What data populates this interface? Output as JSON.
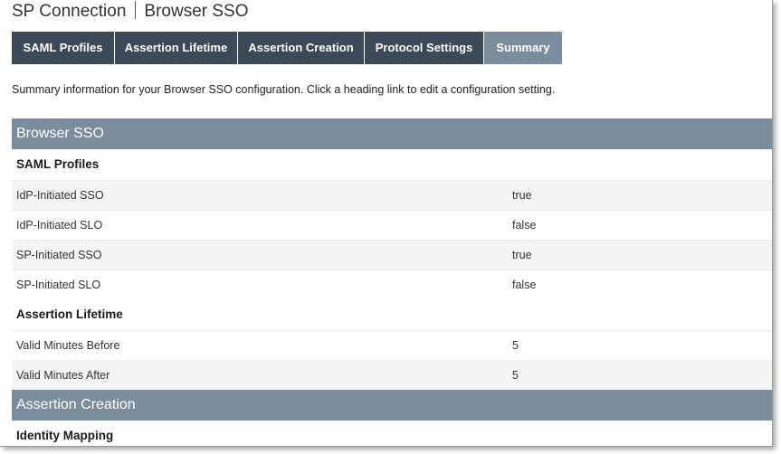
{
  "header": {
    "title": "SP Connection",
    "subtitle": "Browser SSO"
  },
  "tabs": [
    {
      "label": "SAML Profiles",
      "active": false
    },
    {
      "label": "Assertion Lifetime",
      "active": false
    },
    {
      "label": "Assertion Creation",
      "active": false
    },
    {
      "label": "Protocol Settings",
      "active": false
    },
    {
      "label": "Summary",
      "active": true
    }
  ],
  "intro_text": "Summary information for your Browser SSO configuration. Click a heading link to edit a configuration setting.",
  "summary": {
    "browser_sso": {
      "title": "Browser SSO",
      "saml_profiles": {
        "title": "SAML Profiles",
        "rows": [
          {
            "label": "IdP-Initiated SSO",
            "value": "true"
          },
          {
            "label": "IdP-Initiated SLO",
            "value": "false"
          },
          {
            "label": "SP-Initiated SSO",
            "value": "true"
          },
          {
            "label": "SP-Initiated SLO",
            "value": "false"
          }
        ]
      },
      "assertion_lifetime": {
        "title": "Assertion Lifetime",
        "rows": [
          {
            "label": "Valid Minutes Before",
            "value": "5"
          },
          {
            "label": "Valid Minutes After",
            "value": "5"
          }
        ]
      }
    },
    "assertion_creation": {
      "title": "Assertion Creation",
      "identity_mapping": {
        "title": "Identity Mapping"
      }
    }
  },
  "colors": {
    "tab_bg": "#3b4a56",
    "tab_active_bg": "#7b8c9c",
    "section_bar_bg": "#7b8c9c",
    "row_shade_bg": "#f4f4f4"
  }
}
